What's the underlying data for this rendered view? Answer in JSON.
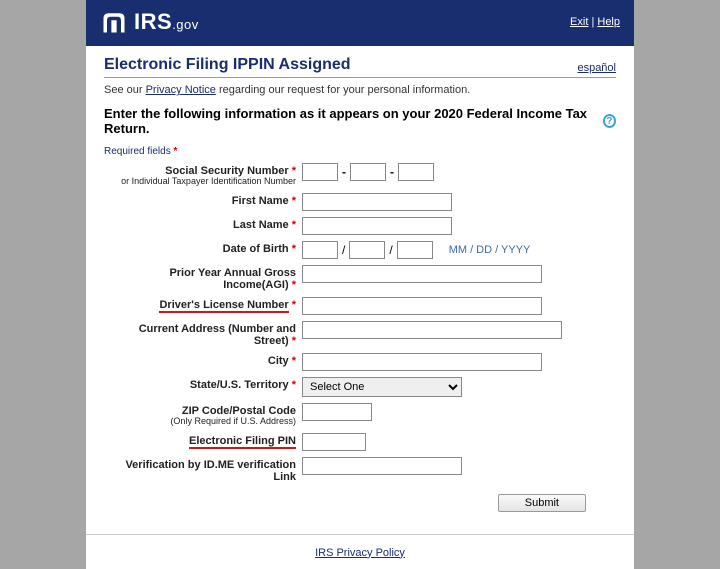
{
  "header": {
    "logo_main": "IRS",
    "logo_suffix": ".gov",
    "exit": "Exit",
    "help": "Help"
  },
  "title": "Electronic Filing IPPIN Assigned",
  "espanol": "español",
  "notice_pre": "See our ",
  "notice_link": "Privacy Notice",
  "notice_post": " regarding our request for your personal information.",
  "instruction": "Enter the following information as it appears on your 2020 Federal Income Tax Return.",
  "required_label": "Required fields ",
  "labels": {
    "ssn": "Social Security Number",
    "ssn_sub": "or Individual Taxpayer Identification Number",
    "first": "First Name",
    "last": "Last Name",
    "dob": "Date of Birth",
    "dob_hint": "MM / DD / YYYY",
    "agi": "Prior Year Annual Gross Income(AGI)",
    "license": "Driver's License Number",
    "address": "Current Address (Number and Street)",
    "city": "City",
    "state": "State/U.S. Territory",
    "zip": "ZIP Code/Postal Code",
    "zip_sub": "(Only Required if U.S. Address)",
    "pin": "Electronic Filing PIN",
    "verify": "Verification by ID.ME verification Link"
  },
  "state_option": "Select One",
  "submit": "Submit",
  "footer_link": "IRS Privacy Policy"
}
